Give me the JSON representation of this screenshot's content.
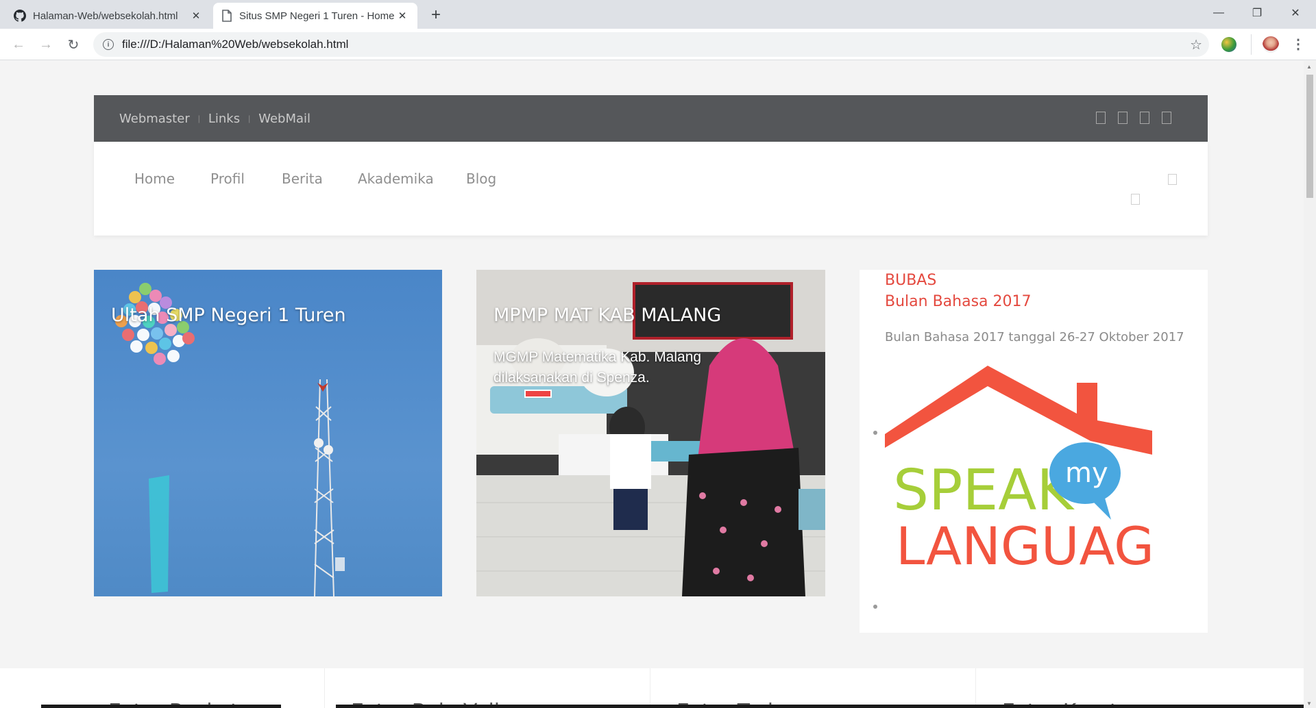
{
  "browser": {
    "tabs": [
      {
        "title": "Halaman-Web/websekolah.html",
        "icon": "github-icon",
        "active": false
      },
      {
        "title": "Situs SMP Negeri 1 Turen - Home",
        "icon": "page-icon",
        "active": true
      }
    ],
    "new_tab": "+",
    "url": "file:///D:/Halaman%20Web/websekolah.html",
    "controls": {
      "minimize": "—",
      "maximize": "❐",
      "close": "✕"
    }
  },
  "site": {
    "topbar_links": [
      "Webmaster",
      "Links",
      "WebMail"
    ],
    "topbar_sep": "|",
    "nav_items": [
      "Home",
      "Profil",
      "Berita",
      "Akademika",
      "Blog"
    ],
    "cards": [
      {
        "title": "Ultah SMP Negeri 1 Turen",
        "text": ""
      },
      {
        "title": "MPMP MAT KAB MALANG",
        "text": "MGMP Matematika Kab. Malang dilaksanakan di Spenza."
      }
    ],
    "feature": {
      "title_line1": "BUBAS",
      "title_line2": "Bulan Bahasa 2017",
      "text": "Bulan Bahasa 2017 tanggal 26-27 Oktober 2017",
      "logo_word1": "SPEAK",
      "logo_word2": "my",
      "logo_word3": "LANGUAGE"
    },
    "extras": [
      "Extra Basket",
      "Extra Bola Voli",
      "Extra Tari",
      "Extra Karate"
    ]
  },
  "colors": {
    "accent_red": "#e4493f",
    "topbar": "#55575a",
    "logo_green": "#a6ce39",
    "logo_blue": "#4aa8e0"
  }
}
